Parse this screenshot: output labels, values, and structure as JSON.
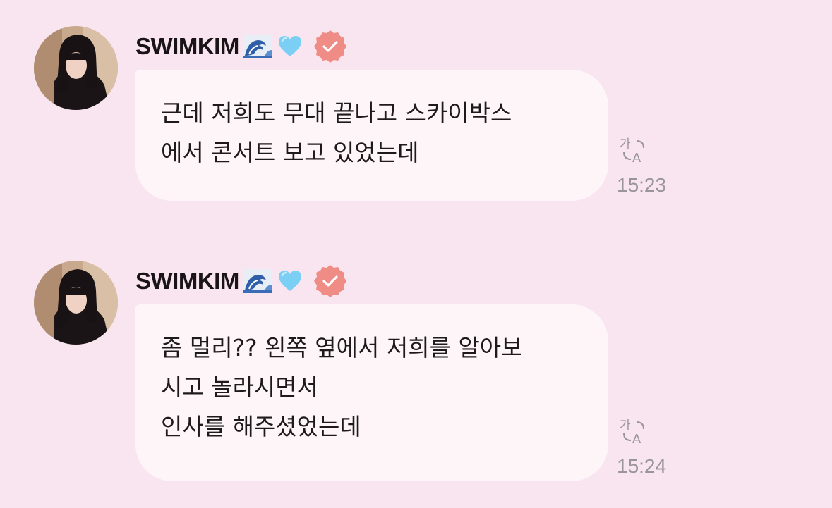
{
  "messages": [
    {
      "sender": "SWIMKIM",
      "lines": [
        "근데 저희도 무대 끝나고 스카이박스",
        "에서 콘서트 보고 있었는데"
      ],
      "time": "15:23",
      "translate_icon": "translate-icon"
    },
    {
      "sender": "SWIMKIM",
      "lines": [
        "좀 멀리?? 왼쪽 옆에서 저희를 알아보",
        "시고 놀라시면서",
        "인사를 해주셨었는데"
      ],
      "time": "15:24",
      "translate_icon": "translate-icon"
    }
  ],
  "icons": {
    "wave": "wave-emoji-icon",
    "heart": "light-blue-heart-icon",
    "badge": "verified-badge-icon"
  },
  "colors": {
    "background": "#f9e5ef",
    "bubble": "#fdf5f8",
    "badge": "#f08c86",
    "heart": "#7ccff4",
    "timestamp": "#9a9598"
  }
}
